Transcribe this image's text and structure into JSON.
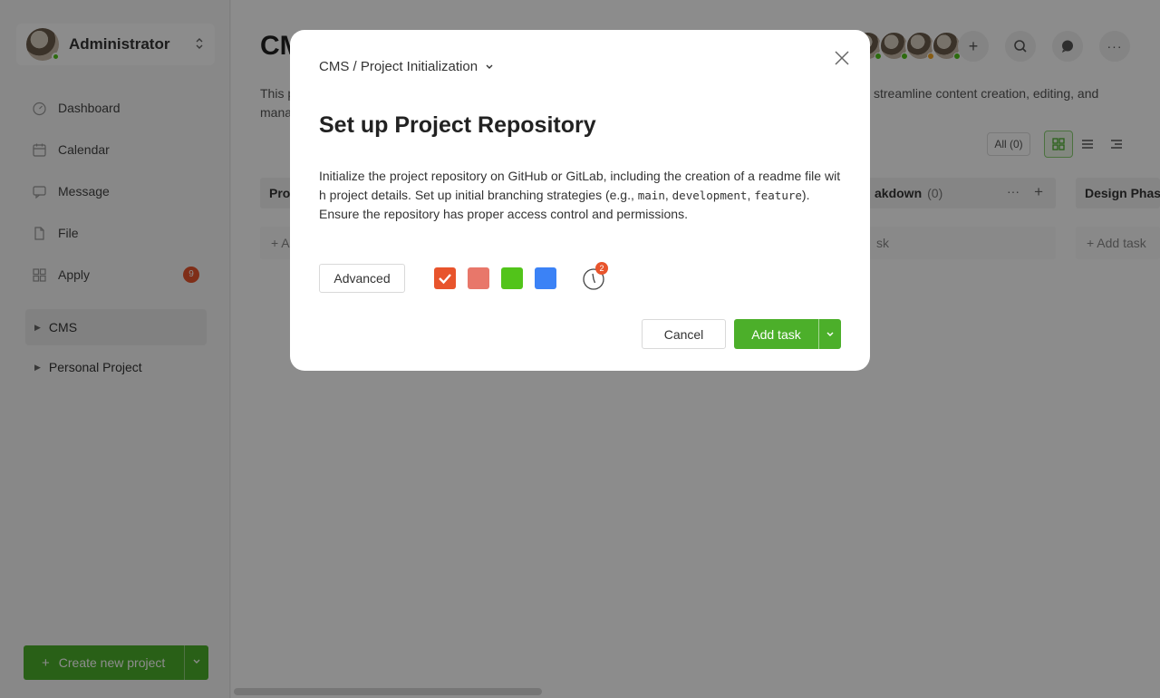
{
  "sidebar": {
    "user_name": "Administrator",
    "nav": [
      {
        "label": "Dashboard",
        "icon": "dashboard-icon"
      },
      {
        "label": "Calendar",
        "icon": "calendar-icon"
      },
      {
        "label": "Message",
        "icon": "message-icon"
      },
      {
        "label": "File",
        "icon": "file-icon"
      },
      {
        "label": "Apply",
        "icon": "apply-icon",
        "badge": "9"
      }
    ],
    "projects": [
      {
        "label": "CMS",
        "active": true
      },
      {
        "label": "Personal Project",
        "active": false
      }
    ],
    "create_label": "Create new project"
  },
  "main": {
    "title": "CMS",
    "description_start": "This p",
    "description_start_2": "mana",
    "description_end": "streamline content creation, editing, and",
    "filter_all": "All (0)",
    "columns": [
      {
        "title": "Pro",
        "count": "",
        "add": "+ A"
      },
      {
        "title": "akdown",
        "count": "(0)",
        "add": "sk"
      },
      {
        "title": "Design Phas",
        "count": "",
        "add": "+ Add task"
      }
    ]
  },
  "modal": {
    "breadcrumb": "CMS / Project Initialization",
    "title": "Set up Project Repository",
    "desc_line1": "Initialize the project repository on GitHub or GitLab, including the creation of a readme file w",
    "desc_line2a": "ith project details. Set up initial branching strategies (e.g., ",
    "code1": "main",
    "code2": "development",
    "code3": "feature",
    "desc_line2b": ").",
    "desc_line3": "Ensure the repository has proper access control and permissions.",
    "advanced_label": "Advanced",
    "colors": [
      "#e8542c",
      "#e8776a",
      "#52c41a",
      "#3b82f6"
    ],
    "selected_color": "#e8542c",
    "clock_badge": "2",
    "cancel_label": "Cancel",
    "add_label": "Add task"
  }
}
